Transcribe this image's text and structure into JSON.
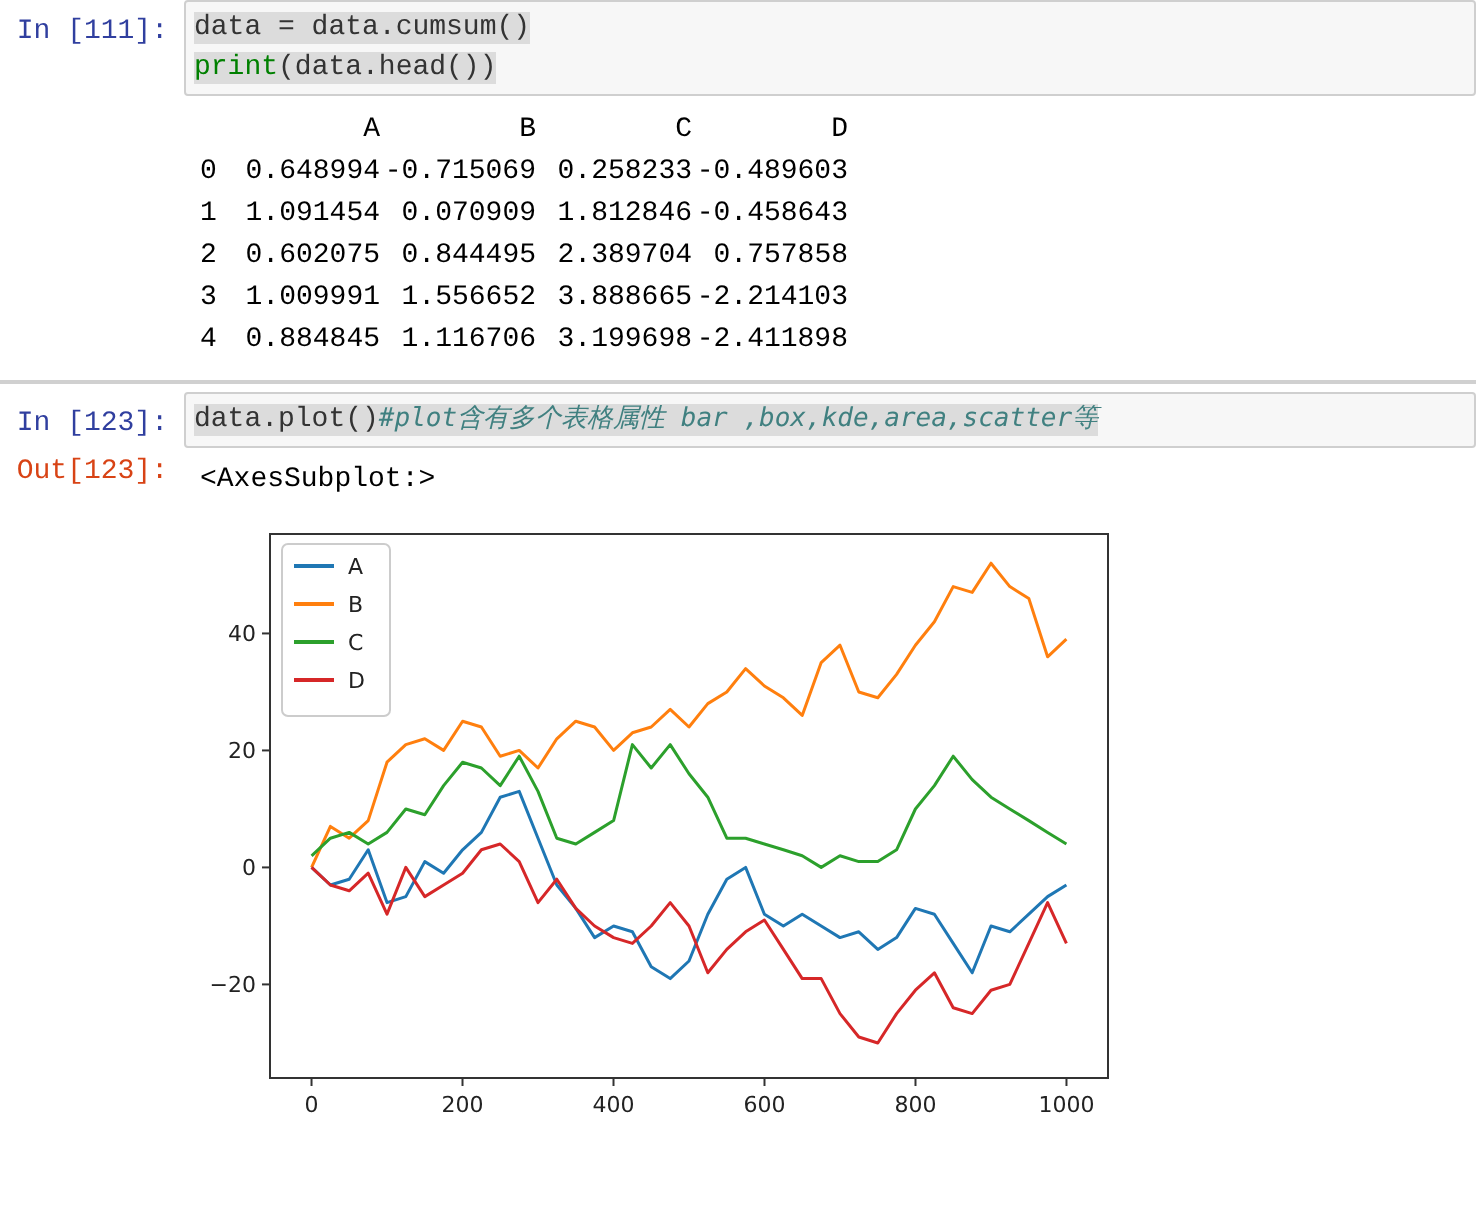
{
  "cells": [
    {
      "prompt": "In [111]:",
      "lines": [
        [
          {
            "kind": "plain",
            "text": "data = data.cumsum()"
          }
        ],
        [
          {
            "kind": "builtin",
            "text": "print"
          },
          {
            "kind": "plain",
            "text": "(data.head())"
          }
        ]
      ],
      "output": {
        "kind": "table",
        "columns": [
          "A",
          "B",
          "C",
          "D"
        ],
        "rows": [
          {
            "index": "0",
            "cells": [
              "0.648994",
              "-0.715069",
              "0.258233",
              "-0.489603"
            ]
          },
          {
            "index": "1",
            "cells": [
              "1.091454",
              "0.070909",
              "1.812846",
              "-0.458643"
            ]
          },
          {
            "index": "2",
            "cells": [
              "0.602075",
              "0.844495",
              "2.389704",
              "0.757858"
            ]
          },
          {
            "index": "3",
            "cells": [
              "1.009991",
              "1.556652",
              "3.888665",
              "-2.214103"
            ]
          },
          {
            "index": "4",
            "cells": [
              "0.884845",
              "1.116706",
              "3.199698",
              "-2.411898"
            ]
          }
        ]
      }
    },
    {
      "prompt": "In [123]:",
      "lines": [
        [
          {
            "kind": "plain",
            "text": "data.plot()"
          },
          {
            "kind": "comment",
            "text": "#plot含有多个表格属性 bar ,box,kde,area,scatter等"
          }
        ]
      ],
      "out_prompt": "Out[123]:",
      "output": {
        "kind": "plot",
        "repr": "<AxesSubplot:>",
        "chart_data": {
          "type": "line",
          "x": [
            0,
            25,
            50,
            75,
            100,
            125,
            150,
            175,
            200,
            225,
            250,
            275,
            300,
            325,
            350,
            375,
            400,
            425,
            450,
            475,
            500,
            525,
            550,
            575,
            600,
            625,
            650,
            675,
            700,
            725,
            750,
            775,
            800,
            825,
            850,
            875,
            900,
            925,
            950,
            975,
            1000
          ],
          "series": [
            {
              "name": "A",
              "color": "#1f77b4",
              "values": [
                0,
                -3,
                -2,
                3,
                -6,
                -5,
                1,
                -1,
                3,
                6,
                12,
                13,
                5,
                -3,
                -7,
                -12,
                -10,
                -11,
                -17,
                -19,
                -16,
                -8,
                -2,
                0,
                -8,
                -10,
                -8,
                -10,
                -12,
                -11,
                -14,
                -12,
                -7,
                -8,
                -13,
                -18,
                -10,
                -11,
                -8,
                -5,
                -3
              ]
            },
            {
              "name": "B",
              "color": "#ff7f0e",
              "values": [
                0,
                7,
                5,
                8,
                18,
                21,
                22,
                20,
                25,
                24,
                19,
                20,
                17,
                22,
                25,
                24,
                20,
                23,
                24,
                27,
                24,
                28,
                30,
                34,
                31,
                29,
                26,
                35,
                38,
                30,
                29,
                33,
                38,
                42,
                48,
                47,
                52,
                48,
                46,
                36,
                39
              ]
            },
            {
              "name": "C",
              "color": "#2ca02c",
              "values": [
                2,
                5,
                6,
                4,
                6,
                10,
                9,
                14,
                18,
                17,
                14,
                19,
                13,
                5,
                4,
                6,
                8,
                21,
                17,
                21,
                16,
                12,
                5,
                5,
                4,
                3,
                2,
                0,
                2,
                1,
                1,
                3,
                10,
                14,
                19,
                15,
                12,
                10,
                8,
                6,
                4
              ]
            },
            {
              "name": "D",
              "color": "#d62728",
              "values": [
                0,
                -3,
                -4,
                -1,
                -8,
                0,
                -5,
                -3,
                -1,
                3,
                4,
                1,
                -6,
                -2,
                -7,
                -10,
                -12,
                -13,
                -10,
                -6,
                -10,
                -18,
                -14,
                -11,
                -9,
                -14,
                -19,
                -19,
                -25,
                -29,
                -30,
                -25,
                -21,
                -18,
                -24,
                -25,
                -21,
                -20,
                -13,
                -6,
                -13
              ]
            }
          ],
          "xlim": [
            -55,
            1055
          ],
          "ylim": [
            -36,
            57
          ],
          "xticks": [
            0,
            200,
            400,
            600,
            800,
            1000
          ],
          "yticks": [
            -20,
            0,
            20,
            40
          ],
          "legend": "upper left"
        }
      }
    }
  ]
}
